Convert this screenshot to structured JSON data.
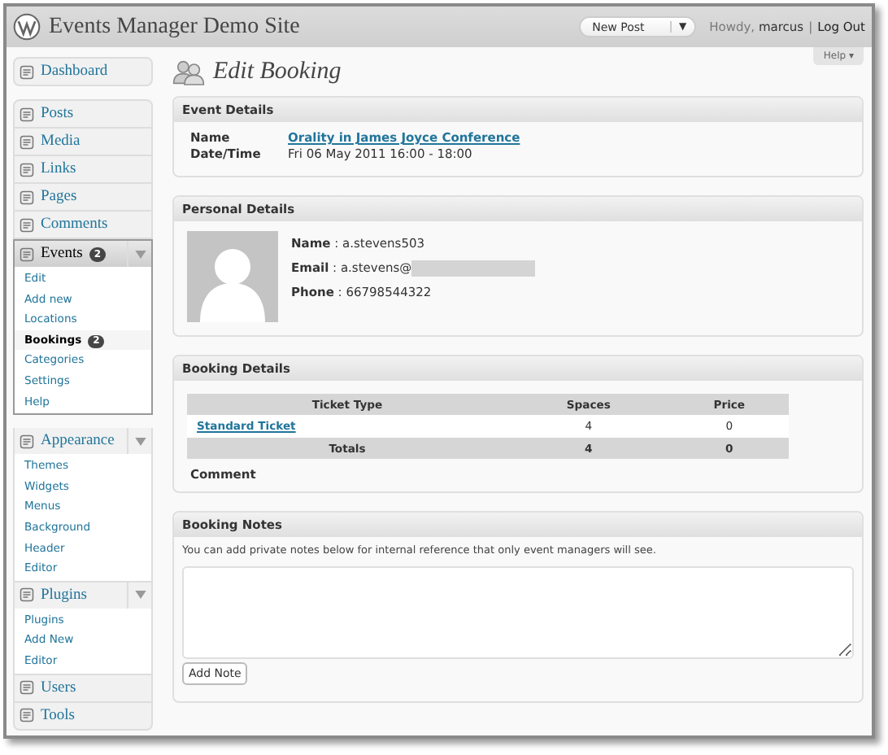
{
  "header": {
    "site_title": "Events Manager Demo Site",
    "new_post": "New Post",
    "dropdown_caret": "▼",
    "greeting": "Howdy,",
    "user": "marcus",
    "divider": "|",
    "logout": "Log Out"
  },
  "help": "Help ▾",
  "sidebar": [
    {
      "label": "Dashboard",
      "current": false,
      "expanded": false
    },
    {
      "label": "Posts",
      "current": false,
      "expanded": false
    },
    {
      "label": "Media",
      "current": false,
      "expanded": false
    },
    {
      "label": "Links",
      "current": false,
      "expanded": false
    },
    {
      "label": "Pages",
      "current": false,
      "expanded": false
    },
    {
      "label": "Comments",
      "current": false,
      "expanded": false
    },
    {
      "label": "Events",
      "current": true,
      "expanded": true,
      "badge": "2",
      "children": [
        {
          "label": "Edit",
          "selected": false
        },
        {
          "label": "Add new",
          "selected": false
        },
        {
          "label": "Locations",
          "selected": false
        },
        {
          "label": "Bookings",
          "selected": true,
          "badge": "2"
        },
        {
          "label": "Categories",
          "selected": false
        },
        {
          "label": "Settings",
          "selected": false
        },
        {
          "label": "Help",
          "selected": false
        }
      ]
    },
    {
      "label": "Appearance",
      "current": false,
      "expanded": true,
      "children": [
        {
          "label": "Themes",
          "selected": false
        },
        {
          "label": "Widgets",
          "selected": false
        },
        {
          "label": "Menus",
          "selected": false
        },
        {
          "label": "Background",
          "selected": false
        },
        {
          "label": "Header",
          "selected": false
        },
        {
          "label": "Editor",
          "selected": false
        }
      ]
    },
    {
      "label": "Plugins",
      "current": false,
      "expanded": true,
      "children": [
        {
          "label": "Plugins",
          "selected": false
        },
        {
          "label": "Add New",
          "selected": false
        },
        {
          "label": "Editor",
          "selected": false
        }
      ]
    },
    {
      "label": "Users",
      "current": false,
      "expanded": false
    },
    {
      "label": "Tools",
      "current": false,
      "expanded": false
    }
  ],
  "page_title": "Edit Booking",
  "event_details": {
    "title": "Event Details",
    "name_label": "Name",
    "name_value": "Orality in James Joyce Conference",
    "date_label": "Date/Time",
    "date_value": "Fri 06 May 2011 16:00 - 18:00"
  },
  "personal_details": {
    "title": "Personal Details",
    "fields": [
      {
        "label": "Name",
        "separator": ":",
        "value": "a.stevens503",
        "redacted": false
      },
      {
        "label": "Email",
        "separator": ":",
        "value": "a.stevens@",
        "redacted": true
      },
      {
        "label": "Phone",
        "separator": ":",
        "value": "66798544322",
        "redacted": false
      }
    ]
  },
  "booking_details": {
    "title": "Booking Details",
    "columns": [
      "Ticket Type",
      "Spaces",
      "Price"
    ],
    "rows": [
      {
        "ticket": "Standard Ticket",
        "spaces": "4",
        "price": "0"
      }
    ],
    "totals": {
      "label": "Totals",
      "spaces": "4",
      "price": "0"
    },
    "comment_label": "Comment"
  },
  "booking_notes": {
    "title": "Booking Notes",
    "hint": "You can add private notes below for internal reference that only event managers will see.",
    "button": "Add Note"
  }
}
